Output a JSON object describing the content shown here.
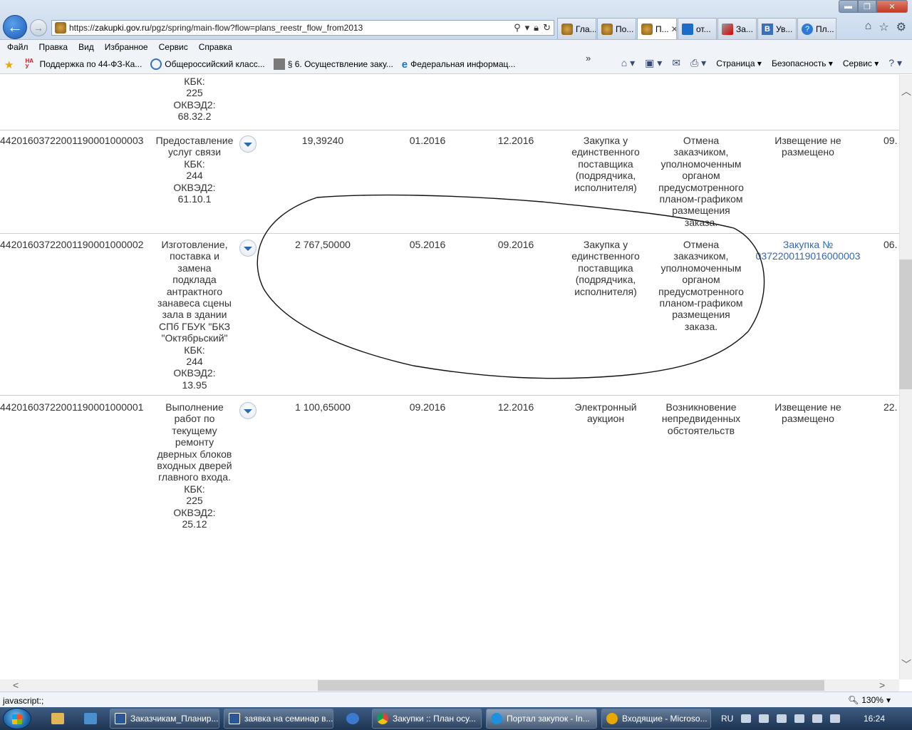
{
  "browser": {
    "url_prefix": "https://",
    "url_domain": "zakupki.gov.ru",
    "url_path": "/pgz/spring/main-flow?flow=plans_reestr_flow_from2013",
    "tabs": [
      {
        "label": "Гла...",
        "icon": "crest-icon"
      },
      {
        "label": "По...",
        "icon": "crest-icon"
      },
      {
        "label": "П...",
        "icon": "crest-icon",
        "active": true
      },
      {
        "label": "от...",
        "icon": "search-icon"
      },
      {
        "label": "За...",
        "icon": "tool-icon"
      },
      {
        "label": "Ув...",
        "icon": "vk-icon"
      },
      {
        "label": "Пл...",
        "icon": "help-icon"
      }
    ],
    "menu": [
      "Файл",
      "Правка",
      "Вид",
      "Избранное",
      "Сервис",
      "Справка"
    ],
    "favorites": [
      "Поддержка по 44-ФЗ-Ка...",
      "Общероссийский класс...",
      "§ 6. Осуществление заку...",
      "Федеральная информац..."
    ],
    "command_bar": {
      "page": "Страница",
      "security": "Безопасность",
      "service": "Сервис",
      "chevron": "»"
    },
    "status_text": "javascript:;",
    "zoom": "130%"
  },
  "table": {
    "top_fragment": {
      "kbk_label": "КБК:",
      "kbk": "225",
      "okved_label": "ОКВЭД2:",
      "okved": "68.32.2"
    },
    "rows": [
      {
        "number": "44201603722001190001000003",
        "name_lines": [
          "Предоставление",
          "услуг связи"
        ],
        "kbk_label": "КБК:",
        "kbk": "244",
        "okved_label": "ОКВЭД2:",
        "okved": "61.10.1",
        "amount": "19,39240",
        "start": "01.2016",
        "end": "12.2016",
        "method_lines": [
          "Закупка у",
          "единственного",
          "поставщика",
          "(подрядчика,",
          "исполнителя)"
        ],
        "reason_lines": [
          "Отмена",
          "заказчиком,",
          "уполномоченным",
          "органом",
          "предусмотренного",
          "планом-графиком",
          "размещения",
          "заказа."
        ],
        "notice_lines": [
          "Извещение не",
          "размещено"
        ],
        "notice_link": false,
        "date_fragment": "09."
      },
      {
        "number": "44201603722001190001000002",
        "name_lines": [
          "Изготовление,",
          "поставка и",
          "замена",
          "подклада",
          "антрактного",
          "занавеса сцены",
          "зала в здании",
          "СПб ГБУК \"БКЗ",
          "\"Октябрьский\""
        ],
        "kbk_label": "КБК:",
        "kbk": "244",
        "okved_label": "ОКВЭД2:",
        "okved": "13.95",
        "amount": "2 767,50000",
        "start": "05.2016",
        "end": "09.2016",
        "method_lines": [
          "Закупка у",
          "единственного",
          "поставщика",
          "(подрядчика,",
          "исполнителя)"
        ],
        "reason_lines": [
          "Отмена",
          "заказчиком,",
          "уполномоченным",
          "органом",
          "предусмотренного",
          "планом-графиком",
          "размещения",
          "заказа."
        ],
        "notice_lines": [
          "Закупка №",
          "0372200119016000003"
        ],
        "notice_link": true,
        "date_fragment": "06."
      },
      {
        "number": "44201603722001190001000001",
        "name_lines": [
          "Выполнение",
          "работ по",
          "текущему",
          "ремонту",
          "дверных блоков",
          "входных дверей",
          "главного входа."
        ],
        "kbk_label": "КБК:",
        "kbk": "225",
        "okved_label": "ОКВЭД2:",
        "okved": "25.12",
        "amount": "1 100,65000",
        "start": "09.2016",
        "end": "12.2016",
        "method_lines": [
          "Электронный",
          "аукцион"
        ],
        "reason_lines": [
          "Возникновение",
          "непредвиденных",
          "обстоятельств"
        ],
        "notice_lines": [
          "Извещение не",
          "размещено"
        ],
        "notice_link": false,
        "date_fragment": "22."
      }
    ]
  },
  "taskbar": {
    "tasks": [
      {
        "label": "Заказчикам_Планир...",
        "icon": "word-icon"
      },
      {
        "label": "заявка на семинар в...",
        "icon": "word-icon"
      },
      {
        "label": "Закупки :: План осу...",
        "icon": "chrome-icon"
      },
      {
        "label": "Портал закупок - In...",
        "icon": "ie-icon",
        "active": true
      },
      {
        "label": "Входящие - Microso...",
        "icon": "outlook-icon"
      }
    ],
    "lang": "RU",
    "time": "16:24"
  }
}
